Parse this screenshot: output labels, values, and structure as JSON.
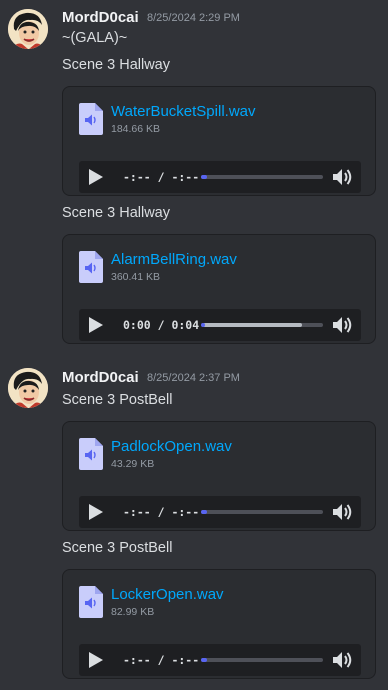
{
  "messages": [
    {
      "username": "MordD0cai",
      "timestamp": "8/25/2024 2:29 PM",
      "lines": [
        "~(GALA)~",
        "Scene 3 Hallway"
      ],
      "attachments": [
        {
          "filename": "WaterBucketSpill.wav",
          "size": "184.66 KB",
          "time": "-:-- / -:--",
          "progress": 0.05
        },
        {
          "caption": "Scene 3 Hallway",
          "filename": "AlarmBellRing.wav",
          "size": "360.41 KB",
          "time": "0:00 / 0:04",
          "progress": 0.02,
          "buffered": 0.83
        }
      ]
    },
    {
      "username": "MordD0cai",
      "timestamp": "8/25/2024 2:37 PM",
      "lines": [
        "Scene 3 PostBell"
      ],
      "attachments": [
        {
          "filename": "PadlockOpen.wav",
          "size": "43.29 KB",
          "time": "-:-- / -:--",
          "progress": 0.05
        },
        {
          "caption": "Scene 3 PostBell",
          "filename": "LockerOpen.wav",
          "size": "82.99 KB",
          "time": "-:-- / -:--",
          "progress": 0.05
        }
      ]
    }
  ],
  "colors": {
    "link": "#00a8fc",
    "accent": "#5865f2",
    "background": "#313338",
    "file_icon": "#c9cdfb"
  }
}
